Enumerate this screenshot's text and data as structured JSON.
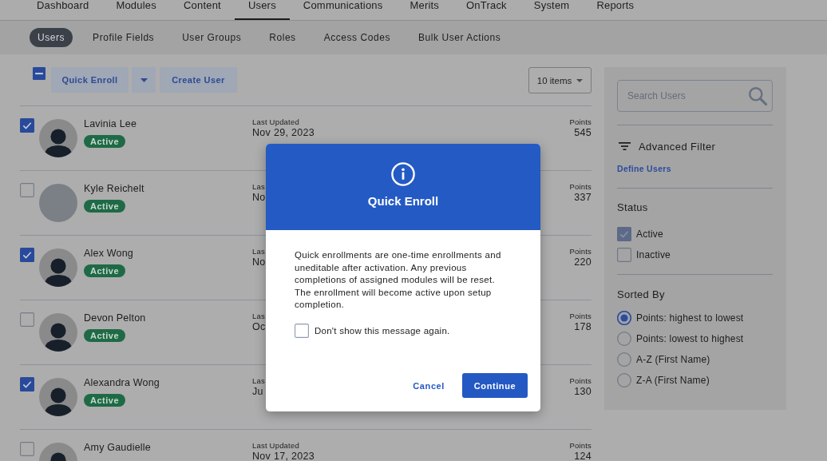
{
  "main_nav": [
    {
      "label": "Dashboard",
      "selected": false
    },
    {
      "label": "Modules",
      "selected": false
    },
    {
      "label": "Content",
      "selected": false
    },
    {
      "label": "Users",
      "selected": true
    },
    {
      "label": "Communications",
      "selected": false
    },
    {
      "label": "Merits",
      "selected": false
    },
    {
      "label": "OnTrack",
      "selected": false
    },
    {
      "label": "System",
      "selected": false
    },
    {
      "label": "Reports",
      "selected": false
    }
  ],
  "sub_nav": [
    {
      "label": "Users",
      "selected": true
    },
    {
      "label": "Profile Fields",
      "selected": false
    },
    {
      "label": "User Groups",
      "selected": false
    },
    {
      "label": "Roles",
      "selected": false
    },
    {
      "label": "Access Codes",
      "selected": false
    },
    {
      "label": "Bulk User Actions",
      "selected": false
    }
  ],
  "toolbar": {
    "select_all": {
      "indeterminate": true
    },
    "quick_enroll": "Quick Enroll",
    "create_user": "Create User",
    "page_size": "10 items"
  },
  "users": [
    {
      "name": "Lavinia Lee",
      "status": "Active",
      "checked": true,
      "avatar": {
        "kind": "silhouette"
      },
      "updated_label": "Last Updated",
      "updated": "Nov 29, 2023",
      "points_label": "Points",
      "points": "545"
    },
    {
      "name": "Kyle Reichelt",
      "status": "Active",
      "checked": false,
      "avatar": {
        "kind": "photo"
      },
      "updated_label": "Las",
      "updated": "No",
      "points_label": "Points",
      "points": "337"
    },
    {
      "name": "Alex Wong",
      "status": "Active",
      "checked": true,
      "avatar": {
        "kind": "silhouette"
      },
      "updated_label": "Las",
      "updated": "No",
      "points_label": "Points",
      "points": "220"
    },
    {
      "name": "Devon Pelton",
      "status": "Active",
      "checked": false,
      "avatar": {
        "kind": "silhouette"
      },
      "updated_label": "Las",
      "updated": "Oc",
      "points_label": "Points",
      "points": "178"
    },
    {
      "name": "Alexandra Wong",
      "status": "Active",
      "checked": true,
      "avatar": {
        "kind": "silhouette"
      },
      "updated_label": "Las",
      "updated": "Ju",
      "points_label": "Points",
      "points": "130"
    },
    {
      "name": "Amy Gaudielle",
      "checked": false,
      "avatar": {
        "kind": "silhouette"
      },
      "updated_label": "Last Updated",
      "updated": "Nov 17, 2023",
      "points_label": "Points",
      "points": "124"
    }
  ],
  "filters": {
    "search": {
      "placeholder": "Search Users"
    },
    "advanced_filter": "Advanced Filter",
    "define_link": "Define Users",
    "status_heading": "Status",
    "status_options": [
      {
        "label": "Active",
        "checked": true
      },
      {
        "label": "Inactive",
        "checked": false
      }
    ],
    "sort_heading": "Sorted By",
    "sort_options": [
      {
        "label": "Points: highest to lowest",
        "selected": true
      },
      {
        "label": "Points: lowest to highest",
        "selected": false
      },
      {
        "label": "A-Z (First Name)",
        "selected": false
      },
      {
        "label": "Z-A (First Name)",
        "selected": false
      }
    ]
  },
  "modal": {
    "title": "Quick Enroll",
    "message": "Quick enrollments are one-time enrollments and uneditable after activation. Any previous completions of assigned modules will be reset. The enrollment will become active upon setup completion.",
    "dont_show_again": {
      "label": "Don't show this message again.",
      "checked": false
    },
    "cancel": "Cancel",
    "continue": "Continue"
  }
}
